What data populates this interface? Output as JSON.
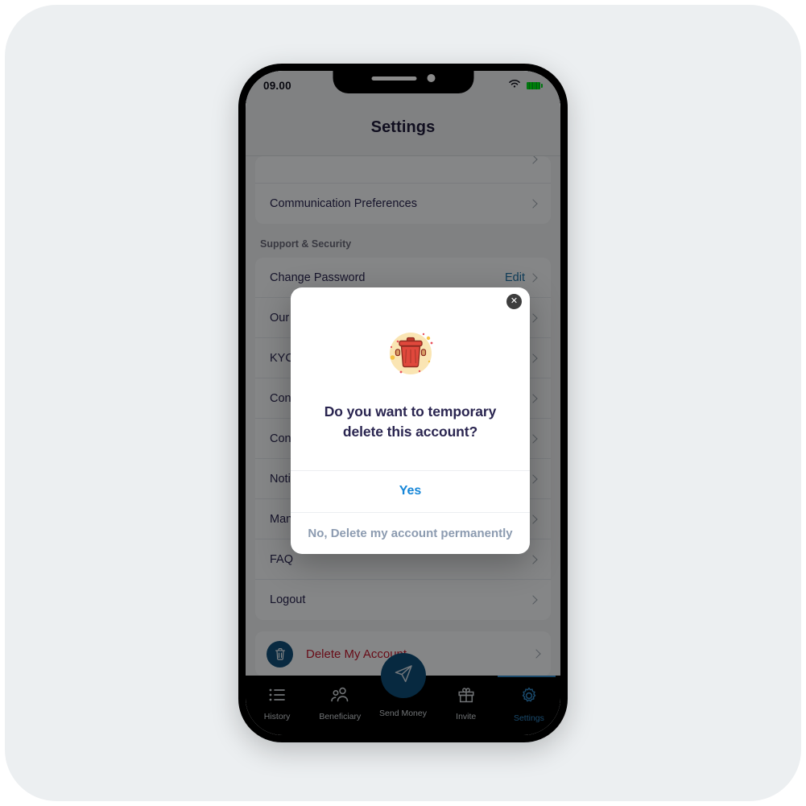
{
  "statusbar": {
    "time": "09.00",
    "wifi_icon": "wifi-icon",
    "battery_icon": "battery-full-icon"
  },
  "header": {
    "title": "Settings"
  },
  "settings": {
    "groups": [
      {
        "title": "",
        "rows": [
          {
            "label": "",
            "action": "",
            "partial": true
          },
          {
            "label": "Communication Preferences",
            "action": ""
          }
        ]
      },
      {
        "title": "Support & Security",
        "rows": [
          {
            "label": "Change Password",
            "action": "Edit"
          },
          {
            "label": "Our Blogs",
            "action": ""
          },
          {
            "label": "KYC Status",
            "action": ""
          },
          {
            "label": "Contact Us",
            "action": ""
          },
          {
            "label": "Contact Support",
            "action": ""
          },
          {
            "label": "Notifications",
            "action": ""
          },
          {
            "label": "Manage Devices",
            "action": ""
          },
          {
            "label": "FAQ",
            "action": ""
          },
          {
            "label": "Logout",
            "action": ""
          }
        ]
      }
    ],
    "delete_account": {
      "label": "Delete My Account",
      "icon": "trash-icon",
      "icon_circle_color": "#114f78",
      "label_color": "#c0182e"
    }
  },
  "modal": {
    "close_label": "✕",
    "illustration": "trash-can-illustration",
    "question": "Do you want to temporary delete this account?",
    "yes_label": "Yes",
    "no_label": "No, Delete my account permanently",
    "yes_color": "#1686d8",
    "no_color": "#8c9bb0"
  },
  "bottomnav": {
    "items": [
      {
        "label": "History",
        "icon": "list-icon",
        "active": false
      },
      {
        "label": "Beneficiary",
        "icon": "people-icon",
        "active": false
      },
      {
        "label": "Send Money",
        "icon": "paper-plane-icon",
        "active": false
      },
      {
        "label": "Invite",
        "icon": "gift-icon",
        "active": false
      },
      {
        "label": "Settings",
        "icon": "gear-icon",
        "active": true
      }
    ],
    "active_color": "#2f86c5",
    "inactive_color": "#cfd4d9",
    "fab_color": "#0d4c76"
  },
  "theme": {
    "page_background": "#ffffff",
    "card_background": "#eceff1",
    "frame_color": "#000000",
    "accent": "#1686d8",
    "text_primary": "#2a2550"
  }
}
